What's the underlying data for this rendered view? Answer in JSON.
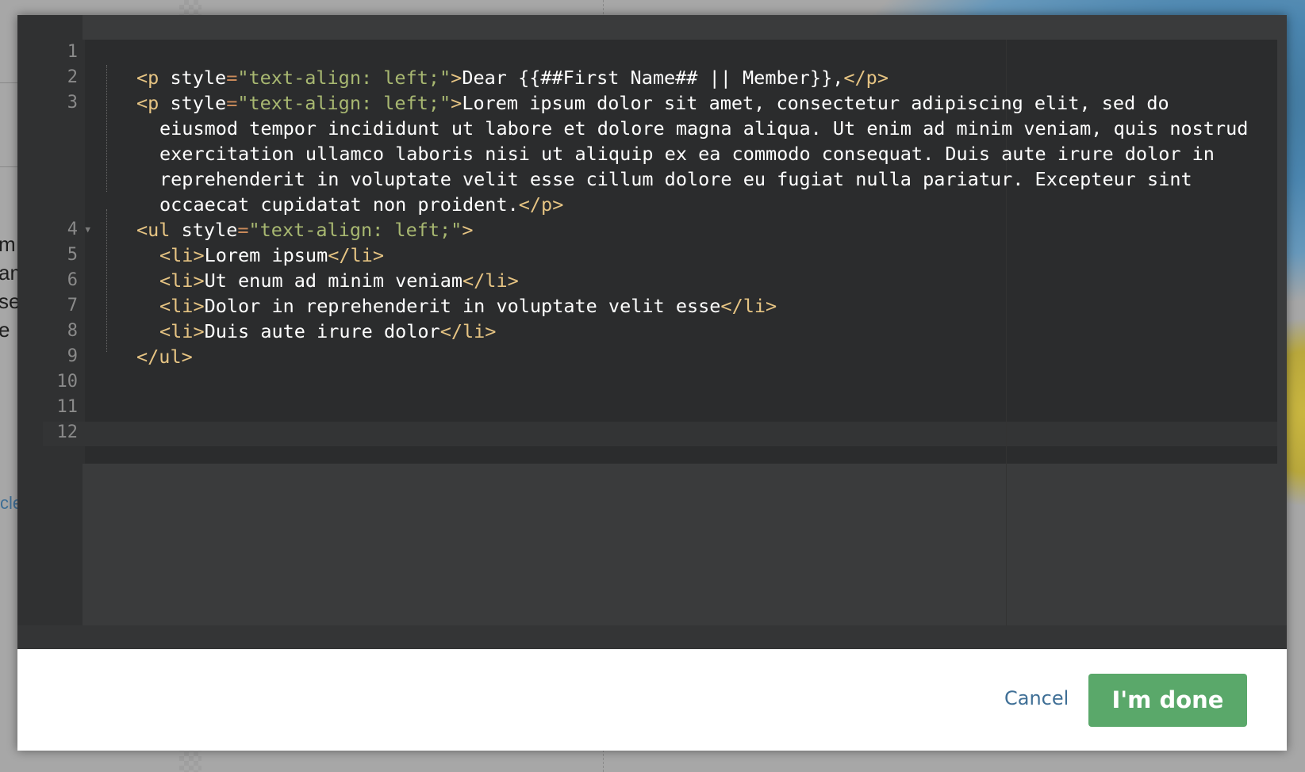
{
  "background": {
    "text_fragments": [
      "m",
      "am",
      "se",
      "e"
    ],
    "link_fragment": "cle"
  },
  "editor": {
    "line_numbers": [
      "1",
      "2",
      "3",
      "4",
      "5",
      "6",
      "7",
      "8",
      "9",
      "10",
      "11",
      "12"
    ],
    "fold_marker_line": "4",
    "lines": {
      "l2": {
        "tag_open": "<p",
        "attr": " style",
        "eq": "=",
        "str": "\"text-align: left;\"",
        "tag_close": ">",
        "text": "Dear {{##First Name## || Member}},",
        "end_tag": "</p>"
      },
      "l3": {
        "tag_open": "<p",
        "attr": " style",
        "eq": "=",
        "str": "\"text-align: left;\"",
        "tag_close": ">",
        "text": "Lorem ipsum dolor sit amet, consectetur adipiscing elit, sed do"
      },
      "l3_wrap1": "eiusmod tempor incididunt ut labore et dolore magna aliqua. Ut enim ad minim veniam, quis nostrud",
      "l3_wrap2": "exercitation ullamco laboris nisi ut aliquip ex ea commodo consequat. Duis aute irure dolor in",
      "l3_wrap3": "reprehenderit in voluptate velit esse cillum dolore eu fugiat nulla pariatur. Excepteur sint",
      "l3_wrap4_text": "occaecat cupidatat non proident.",
      "l3_end_tag": "</p>",
      "l4": {
        "tag_open": "<ul",
        "attr": " style",
        "eq": "=",
        "str": "\"text-align: left;\"",
        "tag_close": ">"
      },
      "l5": {
        "open": "<li>",
        "text": "Lorem ipsum",
        "close": "</li>"
      },
      "l6": {
        "open": "<li>",
        "text": "Ut enum ad minim veniam",
        "close": "</li>"
      },
      "l7": {
        "open": "<li>",
        "text": "Dolor in reprehenderit in voluptate velit esse",
        "close": "</li>"
      },
      "l8": {
        "open": "<li>",
        "text": "Duis aute irure dolor",
        "close": "</li>"
      },
      "l9": "</ul>"
    }
  },
  "footer": {
    "cancel_label": "Cancel",
    "done_label": "I'm done"
  },
  "colors": {
    "tag": "#e6c483",
    "string": "#a8b871",
    "done_button": "#5aa86a",
    "cancel_link": "#3f6f96"
  }
}
